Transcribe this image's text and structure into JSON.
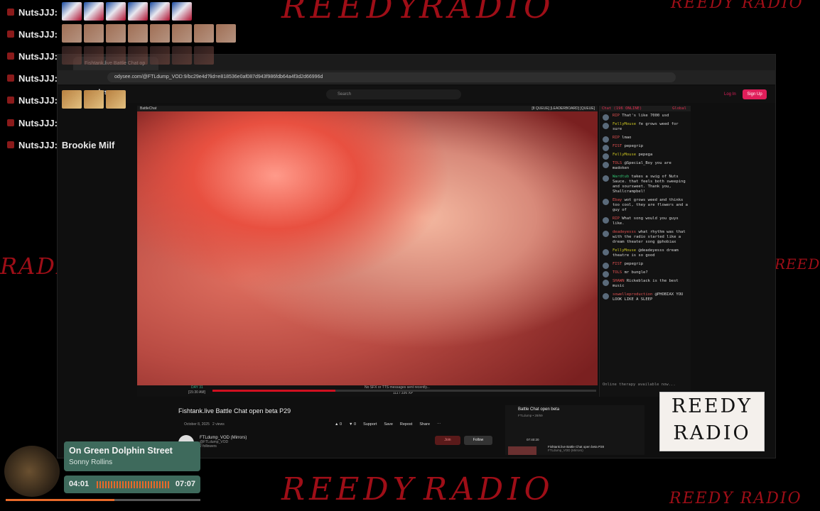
{
  "overlay_chat": {
    "user": "NutsJJJ:",
    "last_message": "Brookie Milf"
  },
  "background": {
    "scrawl_top1": "REEDY",
    "scrawl_top2": "RADIO",
    "scrawl_top3": "REEDY RADIO",
    "scrawl_side_left": "RADIO",
    "scrawl_side_right": "REEDY RADIO",
    "scrawl_bottom1": "REEDY",
    "scrawl_bottom2": "RADIO",
    "scrawl_bottom3": "REEDY RADIO"
  },
  "browser": {
    "tab_title": "Fishtank.live Battle Chat op",
    "url": "odysee.com/@FTLdump_VOD:9/bc29e4d?lid=e818536e0af087d943f986fdb64a4f3d2d66996d",
    "site_logo": "odysee",
    "search_placeholder": "Search",
    "login_label": "Log In",
    "signup_label": "Sign Up"
  },
  "video": {
    "header_left": "BattleChat",
    "header_right": "[8 QUEUE] [LEADERBOARD] [QUEUE]",
    "controls_text": "No SFX or TTS messages sent recently...",
    "controls_xp": "111 / 336 XP",
    "day_label": "DAY 31",
    "timestamp": "[15:30 AM]"
  },
  "chat": {
    "header": "Chat (196 ONLINE)",
    "header_right": "Global",
    "messages": [
      {
        "user": "RIP",
        "text": "That's like 7000 usd"
      },
      {
        "user": "FellyMouse",
        "text": "fe grows weed for sure"
      },
      {
        "user": "RIP",
        "text": "lmao"
      },
      {
        "user": "FIST",
        "text": "pepegrip"
      },
      {
        "user": "FellyMouse",
        "text": "pepega"
      },
      {
        "user": "TOLS",
        "text": "@Special_Boy you are madoken"
      },
      {
        "user": "Wardtub",
        "text": "takes a swig of Nuts Sauce. that feels both sweeping and soursweet. Thank you, Shallcrampbel!"
      },
      {
        "user": "Ebay",
        "text": "wot grows weed and thinks too cool, they are flowers and a guy of"
      },
      {
        "user": "RIP",
        "text": "What song would you guys like."
      },
      {
        "user": "deadeyesss",
        "text": "what rhythm was that with the radio started like a dream theater song @phobiax"
      },
      {
        "user": "FellyMouse",
        "text": "@deadeyesss dream theatre is so good"
      },
      {
        "user": "FIST",
        "text": "pepegrip"
      },
      {
        "user": "TOLS",
        "text": "mr bungle?"
      },
      {
        "user": "SHAWN",
        "text": "Rickeblack is the best music"
      },
      {
        "user": "sowelleproduction",
        "text": "@PHOBIAX YOU LOOK LIKE A SLEEP"
      }
    ],
    "footer": "Online therapy available now..."
  },
  "page": {
    "video_title": "Fishtank.live Battle Chat open beta P29",
    "date": "October 8, 2025",
    "views": "2 views",
    "likes": "0",
    "dislikes": "0",
    "support_label": "Support",
    "save_label": "Save",
    "repost_label": "Repost",
    "share_label": "Share",
    "channel_name": "FTLdump_VOD (Mirrors)",
    "channel_handle": "@FTLdump_VOD",
    "followers": "2 followers",
    "join_label": "Join",
    "follow_label": "Follow"
  },
  "miniplayer": {
    "title": "Battle Chat open beta",
    "subtitle": "FTLdump • 28/69",
    "item_title": "Fishtank.live Battle Chat open beta P28",
    "item_channel": "FTLdump_VOD (Mirrors)",
    "item_duration": "07:40:20"
  },
  "reedy_logo": {
    "line1": "REEDY",
    "line2": "RADIO"
  },
  "music": {
    "title": "On Green Dolphin Street",
    "artist": "Sonny Rollins",
    "current": "04:01",
    "total": "07:07",
    "progress": 0.56
  },
  "colors": {
    "accent": "#e01e5a",
    "scrawl": "#b0101a",
    "widget": "#3e6a5c",
    "music_accent": "#e86a2a"
  }
}
